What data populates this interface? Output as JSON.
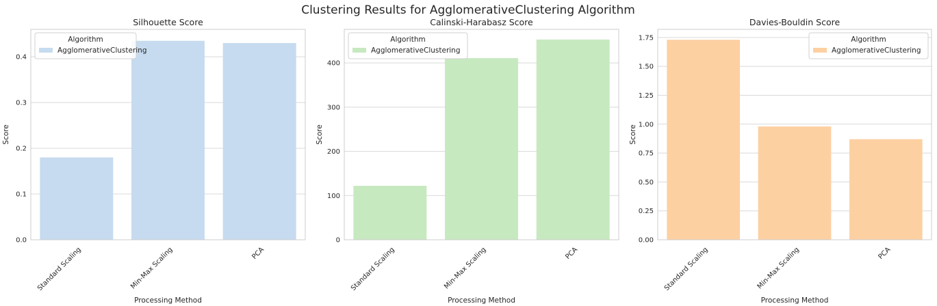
{
  "suptitle": "Clustering Results for AgglomerativeClustering Algorithm",
  "chart_data": [
    {
      "type": "bar",
      "title": "Silhouette Score",
      "xlabel": "Processing Method",
      "ylabel": "Score",
      "categories": [
        "Standard Scaling",
        "Min-Max Scaling",
        "PCA"
      ],
      "series": [
        {
          "name": "AgglomerativeClustering",
          "values": [
            0.18,
            0.435,
            0.43
          ]
        }
      ],
      "ylim": [
        0,
        0.46
      ],
      "yticks": [
        0.0,
        0.1,
        0.2,
        0.3,
        0.4
      ],
      "ytick_labels": [
        "0.0",
        "0.1",
        "0.2",
        "0.3",
        "0.4"
      ],
      "color": "#c6dbef",
      "legend_title": "Algorithm",
      "legend_loc": "top-left",
      "grid": true
    },
    {
      "type": "bar",
      "title": "Calinski-Harabasz Score",
      "xlabel": "Processing Method",
      "ylabel": "Score",
      "categories": [
        "Standard Scaling",
        "Min-Max Scaling",
        "PCA"
      ],
      "series": [
        {
          "name": "AgglomerativeClustering",
          "values": [
            122,
            411,
            453
          ]
        }
      ],
      "ylim": [
        0,
        476
      ],
      "yticks": [
        0,
        100,
        200,
        300,
        400
      ],
      "ytick_labels": [
        "0",
        "100",
        "200",
        "300",
        "400"
      ],
      "color": "#c7e9c0",
      "legend_title": "Algorithm",
      "legend_loc": "top-left",
      "grid": true
    },
    {
      "type": "bar",
      "title": "Davies-Bouldin Score",
      "xlabel": "Processing Method",
      "ylabel": "Score",
      "categories": [
        "Standard Scaling",
        "Min-Max Scaling",
        "PCA"
      ],
      "series": [
        {
          "name": "AgglomerativeClustering",
          "values": [
            1.73,
            0.98,
            0.87
          ]
        }
      ],
      "ylim": [
        0,
        1.82
      ],
      "yticks": [
        0.0,
        0.25,
        0.5,
        0.75,
        1.0,
        1.25,
        1.5,
        1.75
      ],
      "ytick_labels": [
        "0.00",
        "0.25",
        "0.50",
        "0.75",
        "1.00",
        "1.25",
        "1.50",
        "1.75"
      ],
      "color": "#fdd0a2",
      "legend_title": "Algorithm",
      "legend_loc": "top-right",
      "grid": true
    }
  ]
}
